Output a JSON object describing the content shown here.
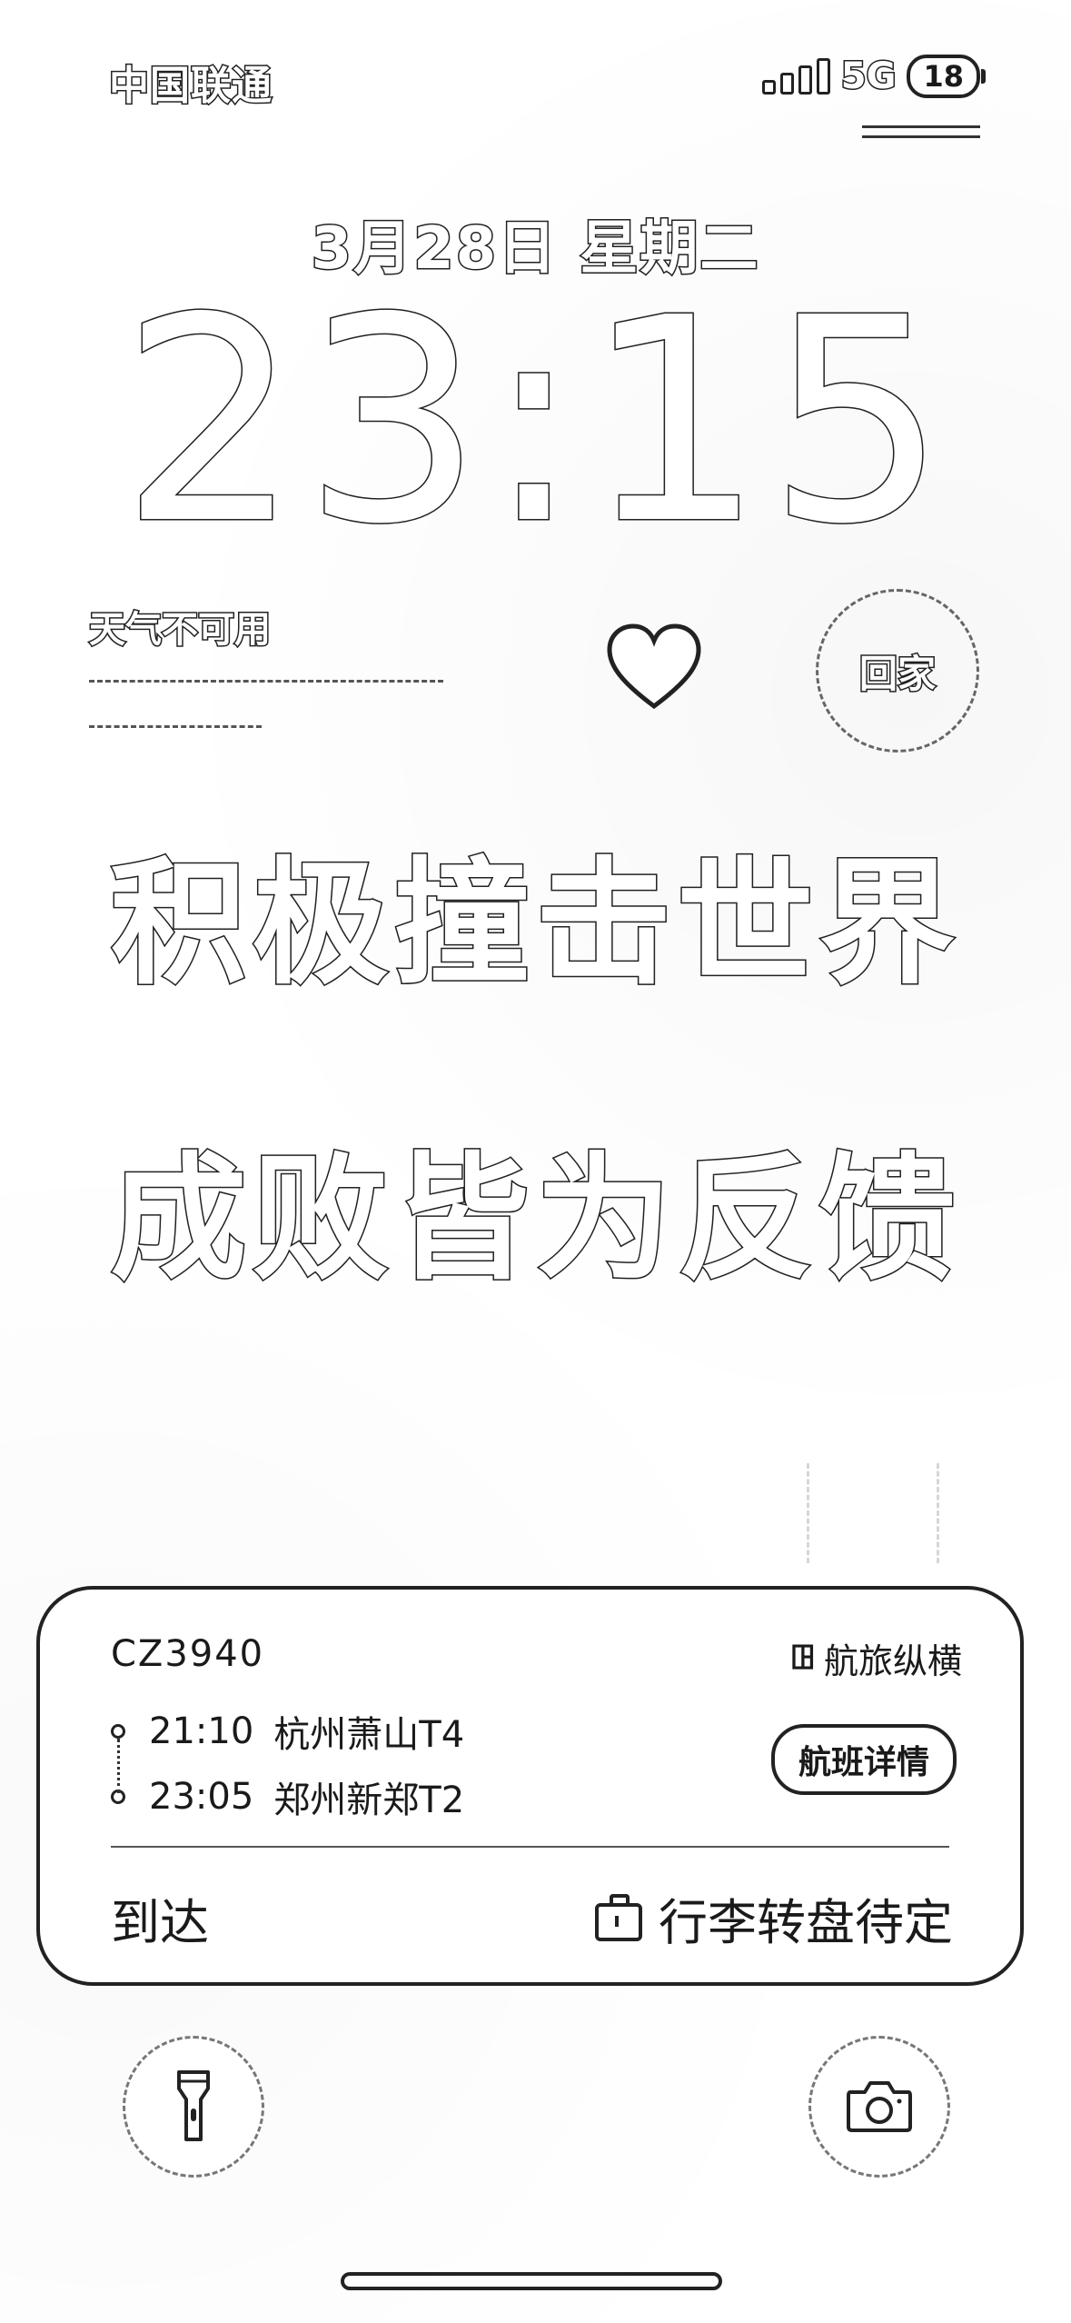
{
  "status_bar": {
    "carrier": "中国联通",
    "network": "5G",
    "battery": "18"
  },
  "lock_screen": {
    "date": "3月28日 星期二",
    "time": "23:15"
  },
  "widgets": {
    "weather": "天气不可用",
    "heart_icon": "heart-icon",
    "go_home": "回家"
  },
  "slogans": {
    "line1": "积极撞击世界",
    "line2": "成败皆为反馈"
  },
  "flight_card": {
    "flight_number": "CZ3940",
    "brand": "航旅纵横",
    "departure": {
      "time": "21:10",
      "place": "杭州萧山T4"
    },
    "arrival": {
      "time": "23:05",
      "place": "郑州新郑T2"
    },
    "details_button": "航班详情",
    "status": "到达",
    "baggage": "行李转盘待定"
  },
  "controls": {
    "flashlight_icon": "flashlight-icon",
    "camera_icon": "camera-icon"
  }
}
